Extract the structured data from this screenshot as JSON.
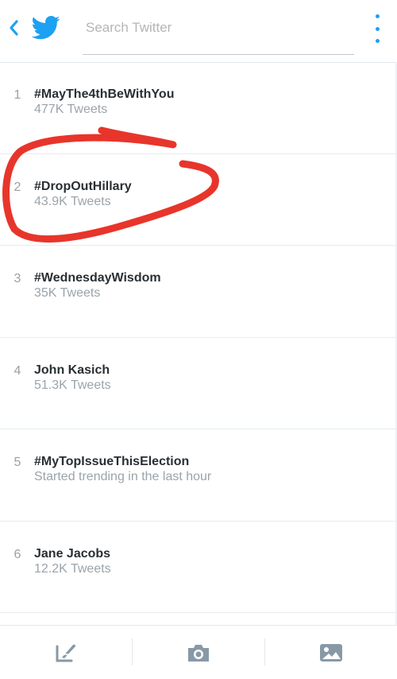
{
  "header": {
    "search_placeholder": "Search Twitter",
    "back_icon": "chevron-left-icon",
    "logo_icon": "twitter-bird-icon",
    "overflow_icon": "vertical-dots-icon",
    "accent_color": "#1da1f2"
  },
  "trends": [
    {
      "rank": "1",
      "name": "#MayThe4thBeWithYou",
      "detail": "477K Tweets"
    },
    {
      "rank": "2",
      "name": "#DropOutHillary",
      "detail": "43.9K Tweets"
    },
    {
      "rank": "3",
      "name": "#WednesdayWisdom",
      "detail": "35K Tweets"
    },
    {
      "rank": "4",
      "name": "John Kasich",
      "detail": "51.3K Tweets"
    },
    {
      "rank": "5",
      "name": "#MyTopIssueThisElection",
      "detail": "Started trending in the last hour"
    },
    {
      "rank": "6",
      "name": "Jane Jacobs",
      "detail": "12.2K Tweets"
    }
  ],
  "annotation": {
    "type": "red-circle-around-trend-2",
    "color": "#e8352b"
  },
  "bottom_bar": {
    "buttons": [
      "compose-icon",
      "camera-icon",
      "image-icon"
    ],
    "icon_color": "#8899a6"
  }
}
